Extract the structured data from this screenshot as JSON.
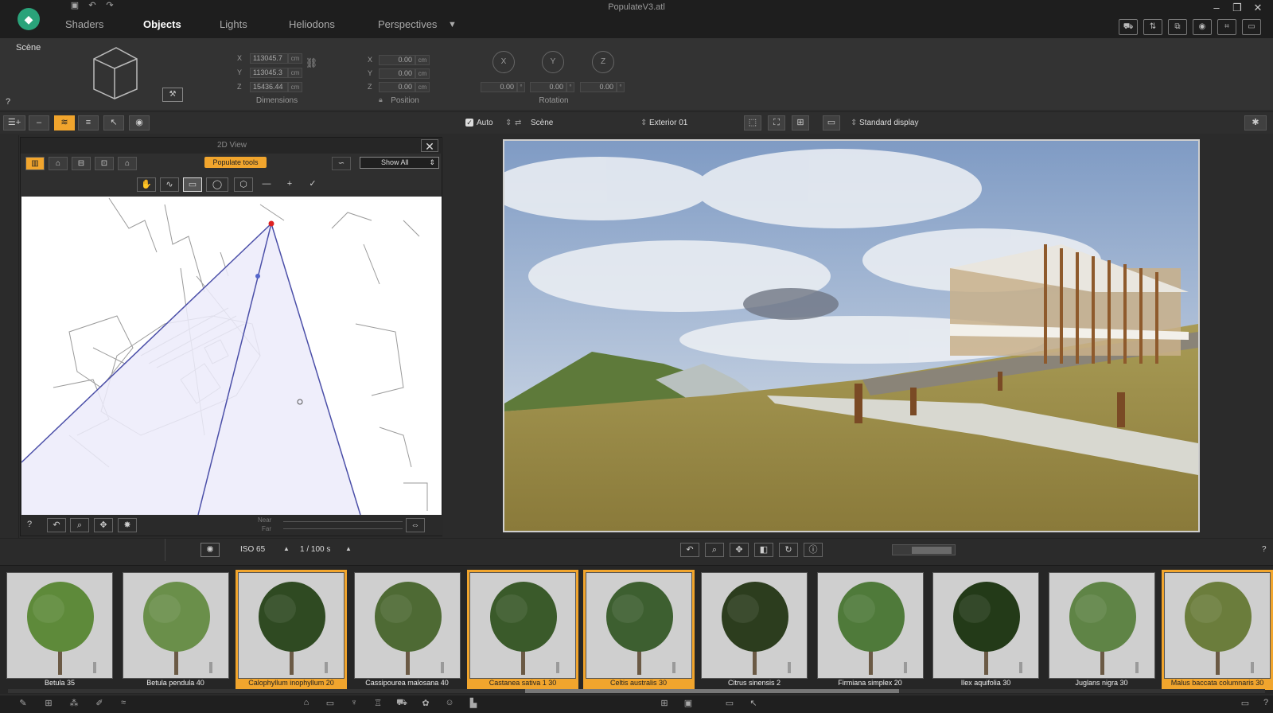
{
  "app": {
    "title": "PopulateV3.atl",
    "logo": "populate-logo-icon",
    "tabs": [
      "Shaders",
      "Objects",
      "Lights",
      "Heliodons",
      "Perspectives"
    ],
    "active_tab": "Objects"
  },
  "properties": {
    "scene_label": "Scène",
    "help": "?",
    "dimensions": {
      "label": "Dimensions",
      "x": "113045.7",
      "y": "113045.3",
      "z": "15436.44",
      "unit": "cm",
      "axis_x": "X",
      "axis_y": "Y",
      "axis_z": "Z"
    },
    "position": {
      "label": "Position",
      "x": "0.00",
      "y": "0.00",
      "z": "0.00",
      "unit": "cm",
      "axis_x": "X",
      "axis_y": "Y",
      "axis_z": "Z"
    },
    "rotation": {
      "label": "Rotation",
      "x_label": "X",
      "y_label": "Y",
      "z_label": "Z",
      "x": "0.00",
      "y": "0.00",
      "z": "0.00",
      "unit": "°"
    }
  },
  "toolbar": {
    "auto_label": "Auto",
    "scene_select": "Scène",
    "camera_select": "Exterior 01",
    "display_select": "Standard display"
  },
  "view2d": {
    "title": "2D View",
    "close": "✕",
    "populate_tools": "Populate tools",
    "show_all": "Show All",
    "near": "Near",
    "far": "Far",
    "help": "?"
  },
  "camera": {
    "iso": "ISO 65",
    "shutter": "1 / 100 s",
    "help": "?"
  },
  "library": {
    "items": [
      {
        "name": "Betula 35",
        "selected": false
      },
      {
        "name": "Betula pendula 40",
        "selected": false
      },
      {
        "name": "Calophyllum inophyllum 20",
        "selected": true
      },
      {
        "name": "Cassipourea malosana 40",
        "selected": false
      },
      {
        "name": "Castanea sativa 1 30",
        "selected": true
      },
      {
        "name": "Celtis australis 30",
        "selected": true
      },
      {
        "name": "Citrus sinensis 2",
        "selected": false
      },
      {
        "name": "Firmiana simplex 20",
        "selected": false
      },
      {
        "name": "Ilex aquifolia 30",
        "selected": false
      },
      {
        "name": "Juglans nigra 30",
        "selected": false
      },
      {
        "name": "Malus baccata columnaris 30",
        "selected": true
      }
    ]
  },
  "colors": {
    "accent": "#f1a52d",
    "brand": "#2aa37a",
    "background": "#2b2b2b"
  },
  "status": {
    "help": "?"
  }
}
